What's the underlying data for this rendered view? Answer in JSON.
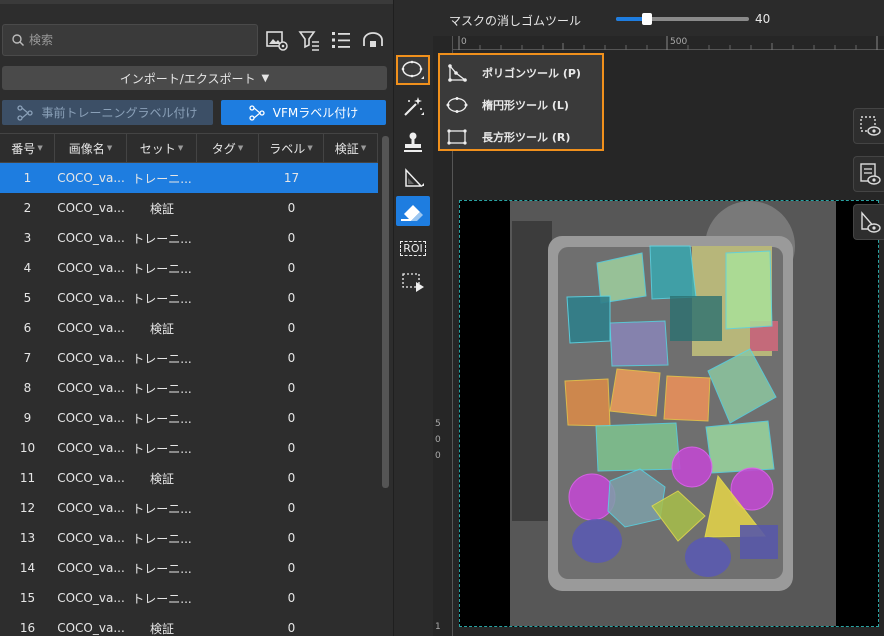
{
  "search": {
    "placeholder": "検索"
  },
  "import_export": {
    "label": "インポート/エクスポート"
  },
  "pretrain_button": {
    "label": "事前トレーニングラベル付け"
  },
  "vfm_button": {
    "label": "VFMラベル付け"
  },
  "table": {
    "headers": [
      "番号",
      "画像名",
      "セット",
      "タグ",
      "ラベル",
      "検証"
    ],
    "rows": [
      {
        "no": "1",
        "name": "COCO_va...",
        "set": "トレーニ...",
        "tag": "",
        "label": "17",
        "selected": true
      },
      {
        "no": "2",
        "name": "COCO_va...",
        "set": "検証",
        "tag": "",
        "label": "0"
      },
      {
        "no": "3",
        "name": "COCO_va...",
        "set": "トレーニ...",
        "tag": "",
        "label": "0"
      },
      {
        "no": "4",
        "name": "COCO_va...",
        "set": "トレーニ...",
        "tag": "",
        "label": "0"
      },
      {
        "no": "5",
        "name": "COCO_va...",
        "set": "トレーニ...",
        "tag": "",
        "label": "0"
      },
      {
        "no": "6",
        "name": "COCO_va...",
        "set": "検証",
        "tag": "",
        "label": "0"
      },
      {
        "no": "7",
        "name": "COCO_va...",
        "set": "トレーニ...",
        "tag": "",
        "label": "0"
      },
      {
        "no": "8",
        "name": "COCO_va...",
        "set": "トレーニ...",
        "tag": "",
        "label": "0"
      },
      {
        "no": "9",
        "name": "COCO_va...",
        "set": "トレーニ...",
        "tag": "",
        "label": "0"
      },
      {
        "no": "10",
        "name": "COCO_va...",
        "set": "トレーニ...",
        "tag": "",
        "label": "0"
      },
      {
        "no": "11",
        "name": "COCO_va...",
        "set": "検証",
        "tag": "",
        "label": "0"
      },
      {
        "no": "12",
        "name": "COCO_va...",
        "set": "トレーニ...",
        "tag": "",
        "label": "0"
      },
      {
        "no": "13",
        "name": "COCO_va...",
        "set": "トレーニ...",
        "tag": "",
        "label": "0"
      },
      {
        "no": "14",
        "name": "COCO_va...",
        "set": "トレーニ...",
        "tag": "",
        "label": "0"
      },
      {
        "no": "15",
        "name": "COCO_va...",
        "set": "トレーニ...",
        "tag": "",
        "label": "0"
      },
      {
        "no": "16",
        "name": "COCO_va...",
        "set": "検証",
        "tag": "",
        "label": "0"
      }
    ]
  },
  "eraser": {
    "label": "マスクの消しゴムツール",
    "value": "40",
    "fraction": 0.23
  },
  "ruler": {
    "h": [
      "0",
      "500"
    ],
    "v": [
      "5",
      "0",
      "0",
      "1"
    ]
  },
  "dropdown": {
    "items": [
      {
        "label": "ポリゴンツール (P)",
        "icon": "polygon-icon"
      },
      {
        "label": "楕円形ツール (L)",
        "icon": "ellipse-icon"
      },
      {
        "label": "長方形ツール (R)",
        "icon": "rectangle-icon"
      }
    ]
  },
  "toolbar": {
    "roi_label": "ROI"
  },
  "colors": {
    "accent": "#1e7de0",
    "highlight": "#f0901c"
  }
}
